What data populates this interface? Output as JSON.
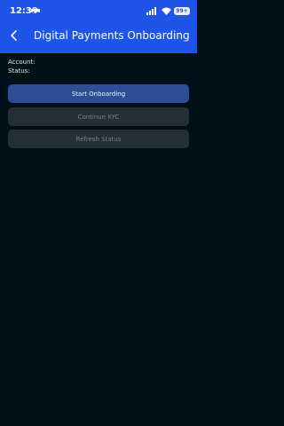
{
  "status_bar": {
    "time": "12:39",
    "battery": "99+"
  },
  "header": {
    "title": "Digital Payments Onboarding"
  },
  "info": {
    "account_label": "Account:",
    "status_label": "Status:"
  },
  "actions": {
    "start_label": "Start Onboarding",
    "continue_label": "Continue KYC",
    "refresh_label": "Refresh Status"
  },
  "colors": {
    "appbar": "#1f54e8",
    "background": "#021019",
    "primary_button": "#2d4e96",
    "disabled_button": "#233038"
  }
}
